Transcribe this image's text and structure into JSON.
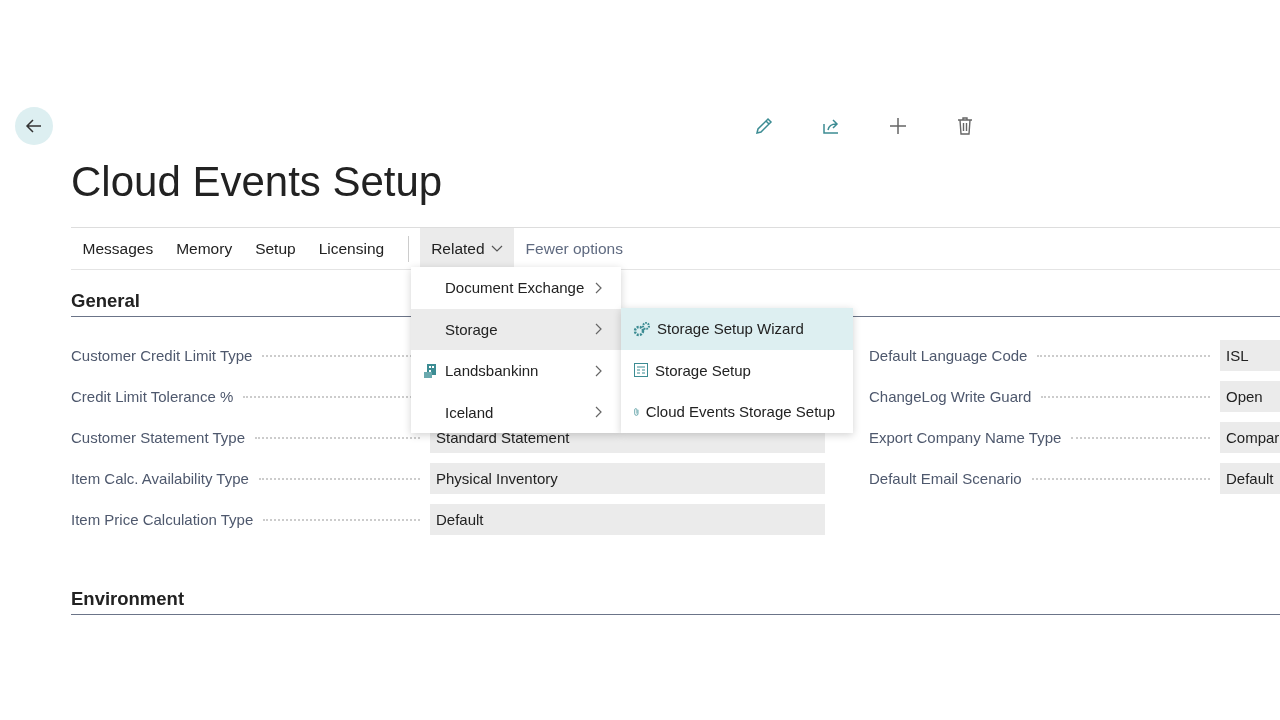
{
  "title": "Cloud Events Setup",
  "actions": [
    {
      "kind": "edit"
    },
    {
      "kind": "share"
    },
    {
      "kind": "new"
    },
    {
      "kind": "delete"
    }
  ],
  "tabs": [
    {
      "label": "Messages",
      "selected": false
    },
    {
      "label": "Memory",
      "selected": false
    },
    {
      "label": "Setup",
      "selected": false
    },
    {
      "label": "Licensing",
      "selected": false
    },
    {
      "label": "Related",
      "selected": true,
      "dropdown": true
    },
    {
      "label": "Fewer options",
      "selected": false,
      "kind": "link"
    }
  ],
  "menu": {
    "items": [
      {
        "label": "Document Exchange",
        "selected": false,
        "icon": false
      },
      {
        "label": "Storage",
        "selected": true,
        "icon": false
      },
      {
        "label": "Landsbankinn",
        "selected": false,
        "icon": true
      },
      {
        "label": "Iceland",
        "selected": false,
        "icon": false
      }
    ],
    "submenu": [
      {
        "label": "Storage Setup Wizard",
        "selected": true,
        "kind": "wizard"
      },
      {
        "label": "Storage Setup",
        "selected": false,
        "kind": "page"
      },
      {
        "label": "Cloud Events Storage Setup",
        "selected": false,
        "kind": "attachment"
      }
    ]
  },
  "sections": [
    {
      "title": "General",
      "left": [
        {
          "label": "Customer Credit Limit Type"
        },
        {
          "label": "Credit Limit Tolerance %"
        },
        {
          "label": "Customer Statement Type",
          "value": "Standard Statement"
        },
        {
          "label": "Item Calc. Availability Type",
          "value": "Physical Inventory"
        },
        {
          "label": "Item Price Calculation Type",
          "value": "Default"
        }
      ],
      "right": [
        {
          "label": "Default Language Code",
          "value": "ISL"
        },
        {
          "label": "ChangeLog Write Guard",
          "value": "Open"
        },
        {
          "label": "Export Company Name Type",
          "value": "Compar"
        },
        {
          "label": "Default Email Scenario",
          "value": "Default"
        }
      ]
    },
    {
      "title": "Environment"
    }
  ]
}
